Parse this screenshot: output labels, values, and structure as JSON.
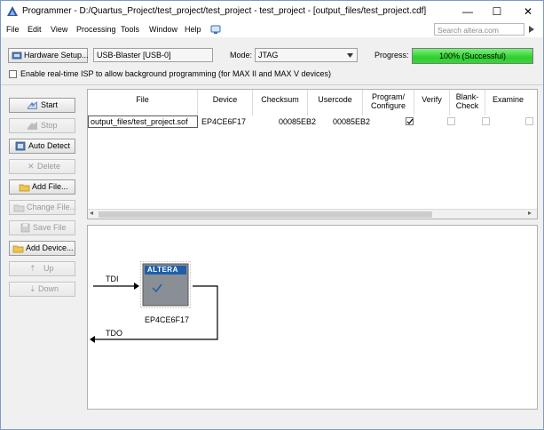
{
  "window": {
    "title": "Programmer - D:/Quartus_Project/test_project/test_project - test_project - [output_files/test_project.cdf]",
    "minimize": "—",
    "maximize": "☐",
    "close": "✕"
  },
  "menu": {
    "items": [
      "File",
      "Edit",
      "View",
      "Processing",
      "Tools",
      "Window",
      "Help"
    ],
    "search_placeholder": "Search altera.com"
  },
  "toolbar": {
    "hardware_setup_label": "Hardware Setup...",
    "hardware_value": "USB-Blaster [USB-0]",
    "mode_label": "Mode:",
    "mode_value": "JTAG",
    "progress_label": "Progress:",
    "progress_text": "100% (Successful)",
    "progress_percent": 100,
    "isp_label": "Enable real-time ISP to allow background programming (for MAX II and MAX V devices)",
    "isp_checked": false
  },
  "sidebar": {
    "buttons": [
      {
        "label": "Start",
        "enabled": true
      },
      {
        "label": "Stop",
        "enabled": false
      },
      {
        "label": "Auto Detect",
        "enabled": true
      },
      {
        "label": "Delete",
        "enabled": false
      },
      {
        "label": "Add File...",
        "enabled": true
      },
      {
        "label": "Change File...",
        "enabled": false
      },
      {
        "label": "Save File",
        "enabled": false
      },
      {
        "label": "Add Device...",
        "enabled": true
      },
      {
        "label": "Up",
        "enabled": false
      },
      {
        "label": "Down",
        "enabled": false
      }
    ]
  },
  "table": {
    "columns": [
      "File",
      "Device",
      "Checksum",
      "Usercode",
      "Program/\nConfigure",
      "Verify",
      "Blank-\nCheck",
      "Examine"
    ],
    "rows": [
      {
        "file": "output_files/test_project.sof",
        "device": "EP4CE6F17",
        "checksum": "00085EB2",
        "usercode": "00085EB2",
        "program": true,
        "verify": false,
        "blank_check": false,
        "examine": false
      }
    ]
  },
  "chain": {
    "tdi_label": "TDI",
    "tdo_label": "TDO",
    "chip_logo": "ALTERA",
    "device_label": "EP4CE6F17"
  },
  "colors": {
    "progress_green": "#2fcf2f",
    "chip_gray": "#8a8f96",
    "altera_blue": "#1f5fa8"
  }
}
